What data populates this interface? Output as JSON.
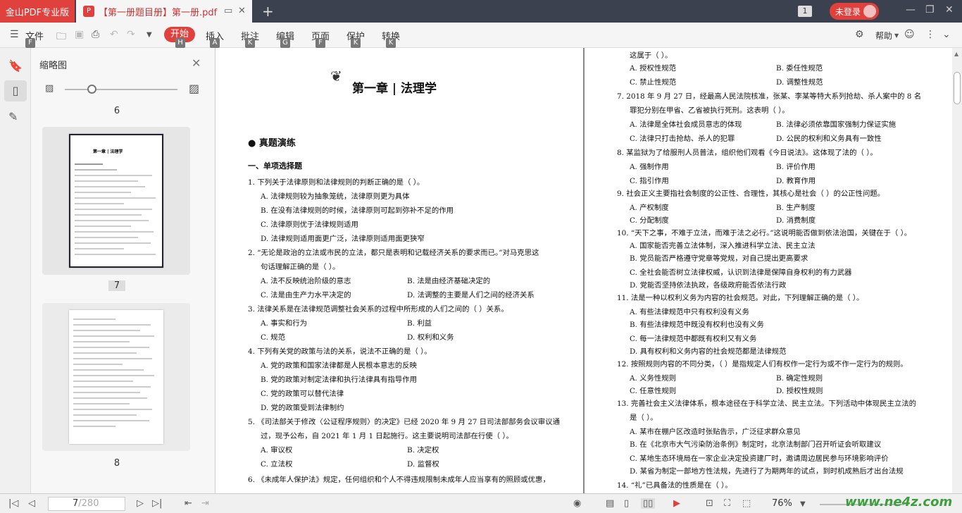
{
  "titlebar": {
    "app_name": "金山PDF专业版",
    "doc_tab_title": "【第一册题目册】第一册.pdf",
    "page_indicator": "1",
    "login_label": "未登录"
  },
  "toolbar": {
    "file_label": "文件",
    "file_key": "F",
    "tabs": [
      {
        "label": "开始",
        "key": "H"
      },
      {
        "label": "插入",
        "key": "A"
      },
      {
        "label": "批注",
        "key": "K"
      },
      {
        "label": "编辑",
        "key": "G"
      },
      {
        "label": "页面",
        "key": "F"
      },
      {
        "label": "保护",
        "key": "K"
      },
      {
        "label": "转换",
        "key": "K"
      }
    ],
    "help_label": "帮助"
  },
  "thumbnail_panel": {
    "title": "缩略图",
    "pages": [
      "6",
      "7",
      "8"
    ],
    "thumb_heading": "第一章 | 法理学"
  },
  "document": {
    "left_page": {
      "chapter": "第一章 | 法理学",
      "section": "真题演练",
      "subsection": "一、单项选择题",
      "lines": [
        "1.  下列关于法律原则和法律规则的判断正确的是（      ）。",
        "A. 法律规则较为抽象笼统，法律原则更为具体",
        "B. 在没有法律规则的时候，法律原则可起到弥补不足的作用",
        "C. 法律原则优于法律规则适用",
        "D. 法律规则适用面更广泛，法律原则适用面更狭窄",
        "2.  “无论是政治的立法或市民的立法，都只是表明和记载经济关系的要求而已。”对马克思这",
        "句话理解正确的是（      ）。",
        "A. 法不反映统治阶级的意志",
        "B. 法是由经济基础决定的",
        "C. 法是由生产力水平决定的",
        "D. 法调整的主要是人们之间的经济关系",
        "3.  法律关系是在法律规范调整社会关系的过程中所形成的人们之间的（      ）关系。",
        "A. 事实和行为",
        "B. 利益",
        "C. 规范",
        "D. 权利和义务",
        "4.  下列有关党的政策与法的关系，说法不正确的是（      ）。",
        "A. 党的政策和国家法律都是人民根本意志的反映",
        "B. 党的政策对制定法律和执行法律具有指导作用",
        "C. 党的政策可以替代法律",
        "D. 党的政策受到法律制约",
        "5.  《司法部关于修改〈公证程序规则〉的决定》已经 2020 年 9 月 27 日司法部部务会议审议通",
        "过，现予公布，自 2021 年 1 月 1 日起施行。这主要说明司法部在行使（      ）。",
        "A. 审议权",
        "B. 决定权",
        "C. 立法权",
        "D. 监督权",
        "6.  《未成年人保护法》规定，任何组织和个人不得违规限制未成年人应当享有的照顾或优惠，"
      ]
    },
    "right_page": {
      "lines": [
        "这属于（      ）。",
        "A. 授权性规范",
        "B. 委任性规范",
        "C. 禁止性规范",
        "D. 调整性规范",
        "7.  2018 年 9 月 27 日，经最高人民法院核准，张某、李某等特大系列抢劫、杀人案中的 8 名",
        "罪犯分别在甲省、乙省被执行死刑。这表明（      ）。",
        "A. 法律是全体社会成员意志的体现",
        "B. 法律必须依靠国家强制力保证实施",
        "C. 法律只打击抢劫、杀人的犯罪",
        "D. 公民的权利和义务具有一致性",
        "8.  某监狱为了给服刑人员普法，组织他们观看《今日说法》。这体现了法的（      ）。",
        "A. 强制作用",
        "B. 评价作用",
        "C. 指引作用",
        "D. 教育作用",
        "9.  社会正义主要指社会制度的公正性、合理性，其核心是社会（      ）的公正性问题。",
        "A. 产权制度",
        "B. 生产制度",
        "C. 分配制度",
        "D. 消费制度",
        "10. “天下之事，不难于立法，而难于法之必行。”这说明能否做到依法治国，关键在于（      ）。",
        "A. 国家能否完善立法体制，深入推进科学立法、民主立法",
        "B. 党员能否严格遵守党章等党规，对自己提出更高要求",
        "C. 全社会能否树立法律权威，认识到法律是保障自身权利的有力武器",
        "D. 党能否坚持依法执政，各级政府能否依法行政",
        "11. 法是一种以权利义务为内容的社会规范。对此，下列理解正确的是（      ）。",
        "A. 有些法律规范中只有权利没有义务",
        "B. 有些法律规范中既没有权利也没有义务",
        "C. 每一法律规范中都既有权利又有义务",
        "D. 具有权利和义务内容的社会规范都是法律规范",
        "12. 按照规则内容的不同分类，（      ）是指规定人们有权作一定行为或不作一定行为的规则。",
        "A. 义务性规则",
        "B. 确定性规则",
        "C. 任意性规则",
        "D. 授权性规则",
        "13. 完善社会主义法律体系，根本途径在于科学立法、民主立法。下列活动中体现民主立法的",
        "是（      ）。",
        "A. 某市在棚户区改造时张贴告示，广泛征求群众意见",
        "B. 在《北京市大气污染防治条例》制定时，北京法制部门召开听证会听取建议",
        "C. 某地生态环境局在一家企业决定投资建厂时，邀请周边居民参与环境影响评价",
        "D. 某省为制定一部地方性法规，先进行了为期两年的试点，到时机成熟后才出台法规",
        "14. “礼”已具备法的性质是在（      ）。"
      ]
    }
  },
  "statusbar": {
    "current_page": "7",
    "total_pages": "/280",
    "zoom": "76%"
  },
  "watermark": "www.ne4z.com"
}
